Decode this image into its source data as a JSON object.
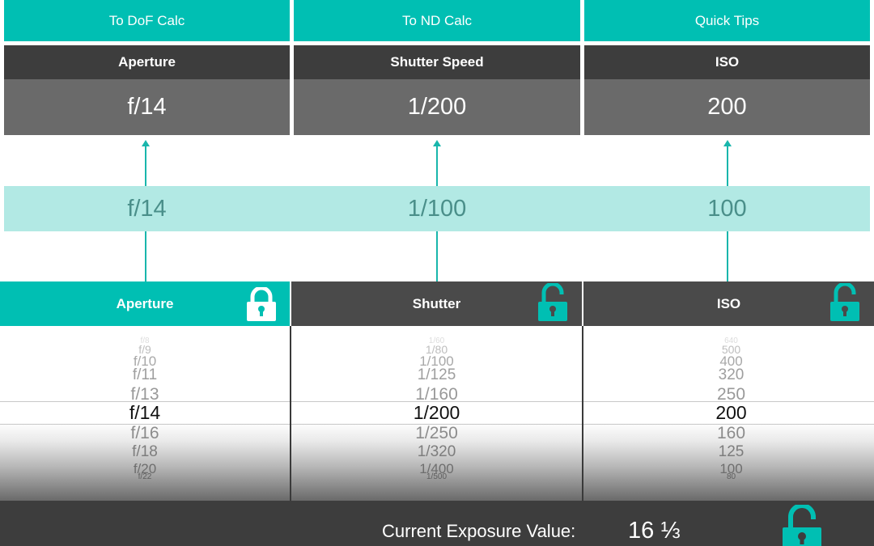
{
  "nav": {
    "dof": "To DoF Calc",
    "nd": "To ND Calc",
    "tips": "Quick Tips"
  },
  "result": {
    "aperture_label": "Aperture",
    "aperture_value": "f/14",
    "shutter_label": "Shutter Speed",
    "shutter_value": "1/200",
    "iso_label": "ISO",
    "iso_value": "200"
  },
  "metered": {
    "aperture": "f/14",
    "shutter": "1/100",
    "iso": "100"
  },
  "pickers": {
    "aperture": {
      "label": "Aperture",
      "locked": true,
      "items": [
        "f/8",
        "f/9",
        "f/10",
        "f/11",
        "f/13",
        "f/14",
        "f/16",
        "f/18",
        "f/20",
        "f/22"
      ]
    },
    "shutter": {
      "label": "Shutter",
      "locked": false,
      "items": [
        "1/60",
        "1/80",
        "1/100",
        "1/125",
        "1/160",
        "1/200",
        "1/250",
        "1/320",
        "1/400",
        "1/500"
      ]
    },
    "iso": {
      "label": "ISO",
      "locked": false,
      "items": [
        "640",
        "500",
        "400",
        "320",
        "250",
        "200",
        "160",
        "125",
        "100",
        "80"
      ]
    }
  },
  "footer": {
    "ev_label": "Current Exposure Value:",
    "ev_value": "16 ⅓",
    "ev_locked": false
  },
  "colors": {
    "accent": "#00bfb3",
    "band": "#b2e9e4",
    "dark": "#3d3d3d"
  }
}
